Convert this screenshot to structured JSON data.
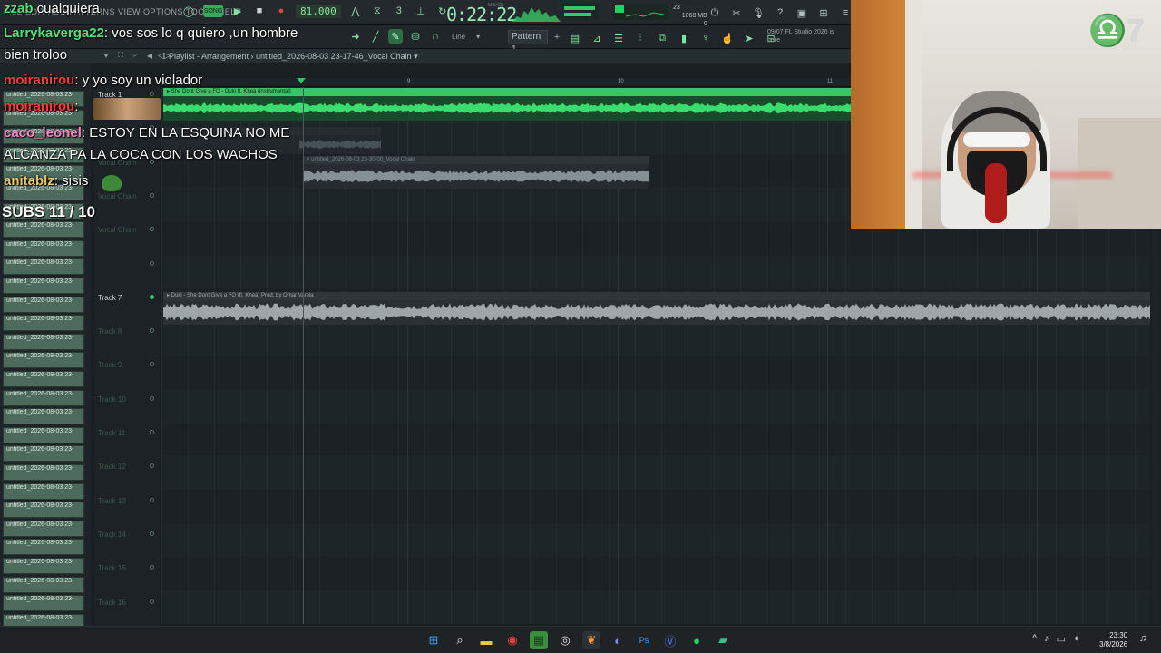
{
  "menu": {
    "text": "FILE EDIT ADD PATTERNS VIEW OPTIONS TOOLS HELP"
  },
  "transport": {
    "mode_label": "SONG",
    "tempo": "81.000",
    "time": "0:22:22",
    "time_unit": "M:S:CS"
  },
  "status": {
    "cpu_value": "23",
    "memory": "1068 MB",
    "memory_sub": "0"
  },
  "toolbar2": {
    "snap_label": "Line",
    "pattern": "Pattern 1"
  },
  "hint": {
    "line1": "09/07  FL Studio 2026 is",
    "line2": "here"
  },
  "playlist": {
    "title": "Playlist - Arrangement › untitled_2026-08-03 23-17-46_Vocal Chain ▾"
  },
  "ruler": {
    "marks": [
      "9",
      "10",
      "11"
    ]
  },
  "browser": {
    "items": [
      "untitled_2026-08-03 23-",
      "untitled_2026-08-03 23-",
      "untitled_2026-08-03 23-",
      "untitled_2026-08-03 23-",
      "untitled_2026-08-03 23-",
      "untitled_2026-08-03 23-",
      "untitled_2026-08-03 23-",
      "untitled_2026-08-03 23-",
      "untitled_2026-08-03 23-",
      "untitled_2026-08-03 23-",
      "untitled_2026-08-03 23-",
      "untitled_2026-08-03 23-",
      "untitled_2026-08-03 23-",
      "untitled_2026-08-03 23-",
      "untitled_2026-08-03 23-",
      "untitled_2026-08-03 23-",
      "untitled_2026-08-03 23-",
      "untitled_2026-08-03 23-",
      "untitled_2026-08-03 23-",
      "untitled_2026-08-03 23-",
      "untitled_2026-08-03 23-",
      "untitled_2026-08-03 23-",
      "untitled_2026-08-03 23-",
      "untitled_2026-08-03 23-",
      "untitled_2026-08-03 23-",
      "untitled_2026-08-03 23-",
      "untitled_2026-08-03 23-",
      "untitled_2026-08-03 23-",
      "untitled_2026-08-03 23-"
    ]
  },
  "tracks": [
    "Track 1",
    "",
    "Vocal Chain",
    "Vocal Chain",
    "Vocal Chain",
    "",
    "Track 7",
    "Track 8",
    "Track 9",
    "Track 10",
    "Track 11",
    "Track 12",
    "Track 13",
    "Track 14",
    "Track 15",
    "Track 16"
  ],
  "clips": {
    "instrumental": "▸ She Dont Give a FO - Duki ft. Khea (instrumental)",
    "vocal": "× untitled_2026-08-03 23-30-00_Vocal Chain",
    "track7": "▸ Duki - She Dont Give a FO (ft. Khea) Prod. by Omar Varela"
  },
  "chat": [
    {
      "user": "zzab",
      "message": " cualquiera",
      "color": "#4de37a"
    },
    {
      "user": "Larrykaverga22",
      "message": ": vos sos lo q quiero ,un hombre",
      "color": "#4de37a"
    },
    {
      "user": "",
      "message": "bien troloo",
      "color": "#ffffff"
    },
    {
      "user": "moiranirou",
      "message": ": y yo soy un violador",
      "color": "#ff3b3b"
    },
    {
      "user": "moiranirou",
      "message": ":",
      "color": "#ff3b3b"
    },
    {
      "user": "caco_leonel",
      "message": ": ESTOY EN LA ESQUINA NO ME",
      "color": "#ff88cc"
    },
    {
      "user": "",
      "message": "ALCANZA PA LA COCA CON LOS WACHOS",
      "color": "#ffffff"
    },
    {
      "user": "anitablz",
      "message": ": sisis",
      "color": "#e8c86a"
    }
  ],
  "subs": "SUBS 11 / 10",
  "taskbar": {
    "apps": [
      "windows-icon",
      "search-icon",
      "folder-icon",
      "chrome-icon",
      "minecraft-icon",
      "obs-icon",
      "fl-studio-icon",
      "discord-icon",
      "photoshop-icon",
      "v-icon",
      "spotify-icon",
      "streamlabs-icon"
    ],
    "time": "23:30",
    "date": "3/8/2026"
  },
  "colors": {
    "accent": "#37c567",
    "clip_green": "#184a2c"
  }
}
